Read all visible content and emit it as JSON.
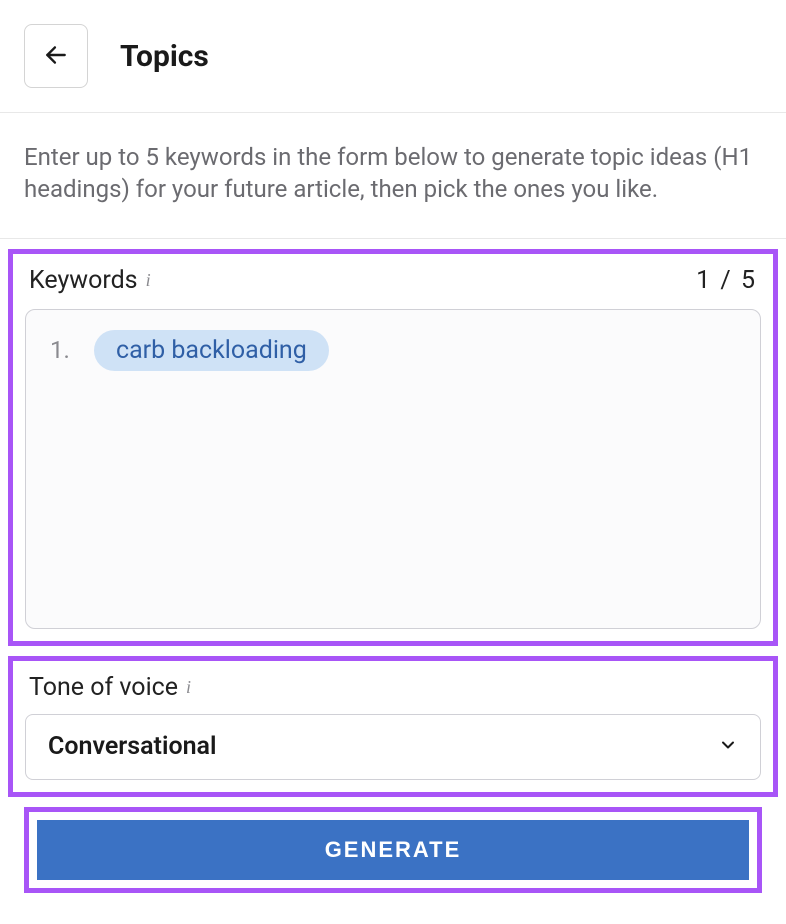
{
  "header": {
    "title": "Topics"
  },
  "instruction": "Enter up to 5 keywords in the form below to generate topic ideas (H1 headings) for your future article, then pick the ones you like.",
  "keywords_section": {
    "label": "Keywords",
    "counter": "1 / 5",
    "items": [
      {
        "num": "1.",
        "text": "carb backloading"
      }
    ]
  },
  "tone_section": {
    "label": "Tone of voice",
    "selected": "Conversational"
  },
  "actions": {
    "generate_label": "GENERATE"
  }
}
